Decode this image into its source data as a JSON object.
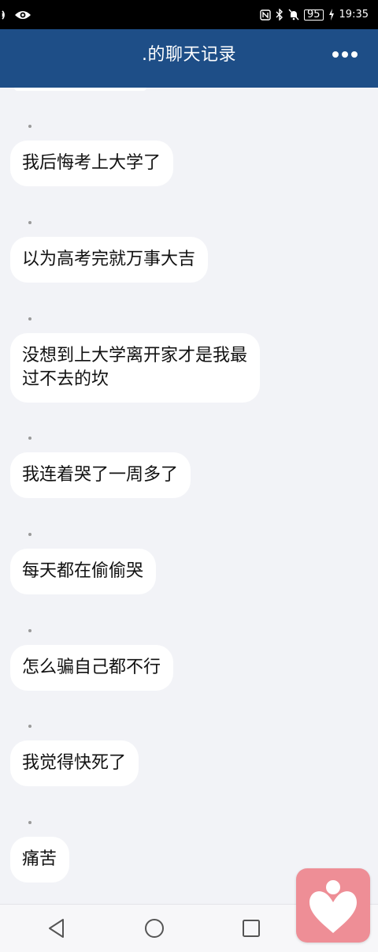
{
  "status_bar": {
    "battery": "95",
    "time": "19:35"
  },
  "header": {
    "title": ".的聊天记录"
  },
  "messages": [
    {
      "text": "我后悔考上大学了"
    },
    {
      "text": "以为高考完就万事大吉"
    },
    {
      "text": "没想到上大学离开家才是我最\n过不去的坎"
    },
    {
      "text": "我连着哭了一周多了"
    },
    {
      "text": "每天都在偷偷哭"
    },
    {
      "text": "怎么骗自己都不行"
    },
    {
      "text": "我觉得快死了"
    },
    {
      "text": "痛苦"
    }
  ],
  "icons": {
    "more": "more-dots-icon",
    "back": "nav-back-icon",
    "home": "nav-home-icon",
    "recent": "nav-recent-icon",
    "floating_app": "heart-person-icon"
  },
  "colors": {
    "header_bg": "#1e4e87",
    "chat_bg": "#f2f3f7",
    "bubble_bg": "#ffffff",
    "floating_app_bg": "#ee8e96"
  }
}
